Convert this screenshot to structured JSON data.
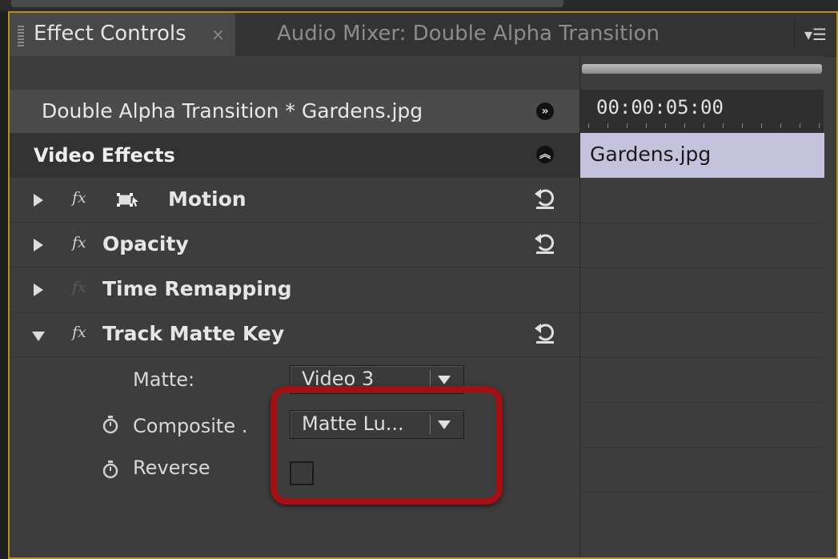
{
  "tabs": {
    "active": {
      "label": "Effect Controls",
      "close": "×"
    },
    "inactive": {
      "label": "Audio Mixer: Double Alpha Transition"
    },
    "menu_icon": "panel-menu-icon"
  },
  "header": {
    "clip_title": "Double Alpha Transition * Gardens.jpg"
  },
  "section": {
    "title": "Video Effects"
  },
  "effects": [
    {
      "name": "Motion",
      "fx": "fx",
      "expanded": false
    },
    {
      "name": "Opacity",
      "fx": "fx",
      "expanded": false
    },
    {
      "name": "Time Remapping",
      "fx": "fx",
      "expanded": false
    },
    {
      "name": "Track Matte Key",
      "fx": "fx",
      "expanded": true
    }
  ],
  "track_matte": {
    "matte_label": "Matte:",
    "matte_value": "Video 3",
    "composite_label": "Composite .",
    "composite_value": "Matte Lu...",
    "reverse_label": "Reverse",
    "reverse_checked": false
  },
  "timeline": {
    "timecode": "00:00:05:00",
    "clip": "Gardens.jpg"
  },
  "colors": {
    "accent_border": "#b88f1e",
    "highlight": "#a60f12",
    "clip_bar": "#c4c2dd"
  }
}
